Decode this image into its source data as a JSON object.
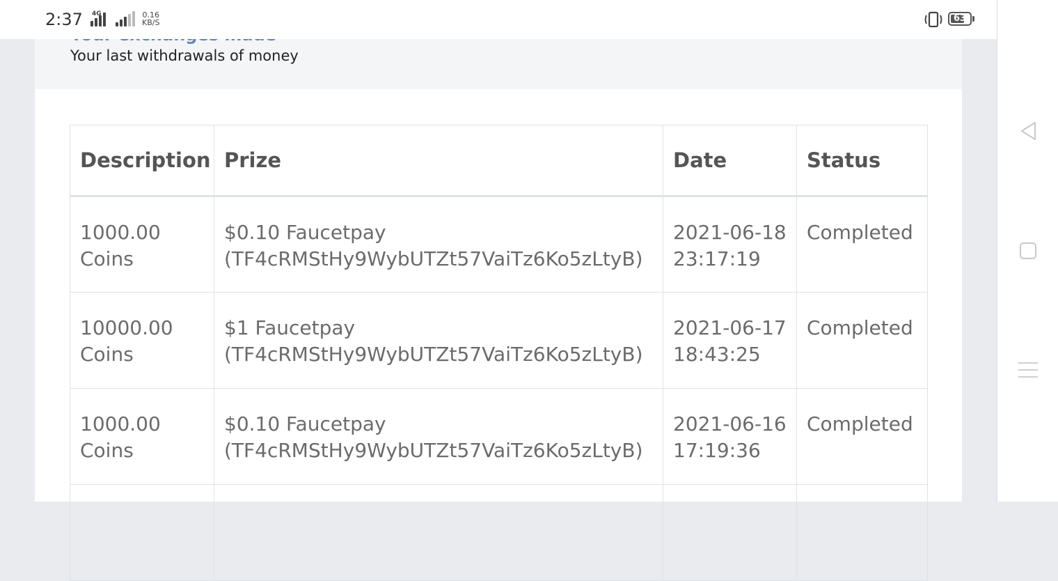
{
  "status_bar": {
    "time": "2:37",
    "network": "4G",
    "speed_value": "0.16",
    "speed_unit": "KB/S",
    "battery": "63"
  },
  "card": {
    "title": "Your exchanges made",
    "subtitle": "Your last withdrawals of money"
  },
  "table": {
    "headers": {
      "description": "Description",
      "prize": "Prize",
      "date": "Date",
      "status": "Status"
    },
    "rows": [
      {
        "description": "1000.00 Coins",
        "prize_amount": "$0.10 Faucetpay",
        "prize_address": "(TF4cRMStHy9WybUTZt57VaiTz6Ko5zLtyB)",
        "date": "2021-06-18 23:17:19",
        "status": "Completed"
      },
      {
        "description": "10000.00 Coins",
        "prize_amount": "$1 Faucetpay",
        "prize_address": "(TF4cRMStHy9WybUTZt57VaiTz6Ko5zLtyB)",
        "date": "2021-06-17 18:43:25",
        "status": "Completed"
      },
      {
        "description": "1000.00 Coins",
        "prize_amount": "$0.10 Faucetpay",
        "prize_address": "(TF4cRMStHy9WybUTZt57VaiTz6Ko5zLtyB)",
        "date": "2021-06-16 17:19:36",
        "status": "Completed"
      },
      {
        "description": "",
        "prize_amount": "",
        "prize_address": "",
        "date": "",
        "status": ""
      }
    ]
  }
}
